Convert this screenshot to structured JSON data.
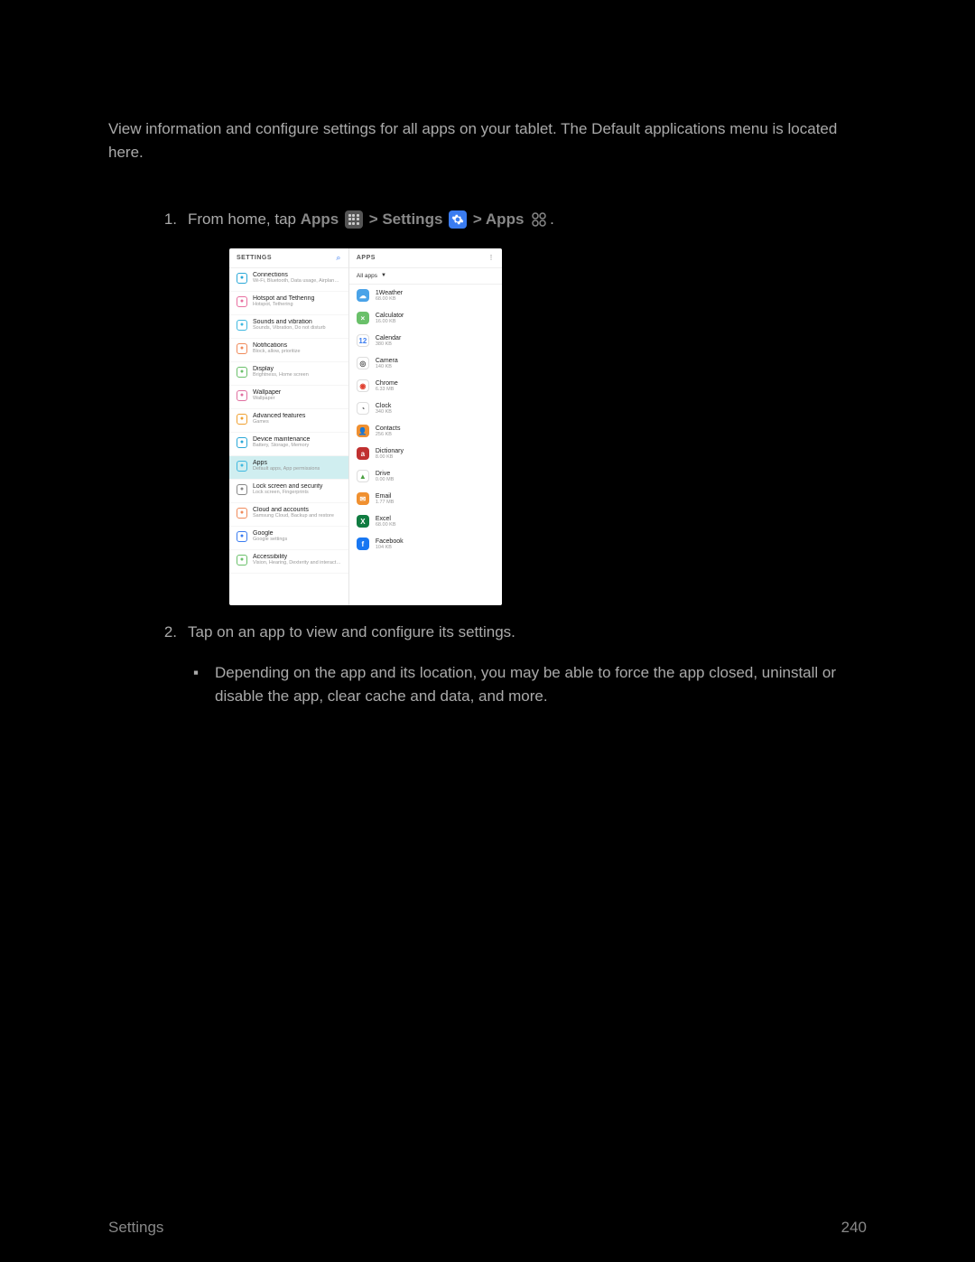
{
  "doc": {
    "intro": "View information and configure settings for all apps on your tablet. The Default applications menu is located here.",
    "step1_prefix": "From home, tap ",
    "step1_apps": "Apps",
    "step1_sep1": " > ",
    "step1_settings": "Settings",
    "step1_sep2": " > ",
    "step1_apps2": "Apps",
    "step1_suffix": ".",
    "step2": "Tap on an app to view and configure its settings.",
    "bullet": "Depending on the app and its location, you may be able to force the app closed, uninstall or disable the app, clear cache and data, and more.",
    "footer_left": "Settings",
    "footer_right": "240"
  },
  "screenshot": {
    "left_header": "SETTINGS",
    "right_header": "APPS",
    "more_glyph": "⋮",
    "filter_label": "All apps",
    "settings_items": [
      {
        "title": "Connections",
        "sub": "Wi-Fi, Bluetooth, Data usage, Airplane m...",
        "color": "#2aa8d8"
      },
      {
        "title": "Hotspot and Tethering",
        "sub": "Hotspot, Tethering",
        "color": "#e86fa0"
      },
      {
        "title": "Sounds and vibration",
        "sub": "Sounds, Vibration, Do not disturb",
        "color": "#3fb8e0"
      },
      {
        "title": "Notifications",
        "sub": "Block, allow, prioritize",
        "color": "#f08a5a"
      },
      {
        "title": "Display",
        "sub": "Brightness, Home screen",
        "color": "#6ac06a"
      },
      {
        "title": "Wallpaper",
        "sub": "Wallpaper",
        "color": "#e06fa0"
      },
      {
        "title": "Advanced features",
        "sub": "Games",
        "color": "#f0a030"
      },
      {
        "title": "Device maintenance",
        "sub": "Battery, Storage, Memory",
        "color": "#2aa8d8"
      },
      {
        "title": "Apps",
        "sub": "Default apps, App permissions",
        "color": "#3fb8e0",
        "selected": true
      },
      {
        "title": "Lock screen and security",
        "sub": "Lock screen, Fingerprints",
        "color": "#888"
      },
      {
        "title": "Cloud and accounts",
        "sub": "Samsung Cloud, Backup and restore",
        "color": "#f08a5a"
      },
      {
        "title": "Google",
        "sub": "Google settings",
        "color": "#3a7cf0"
      },
      {
        "title": "Accessibility",
        "sub": "Vision, Hearing, Dexterity and interaction",
        "color": "#6ac06a"
      }
    ],
    "apps": [
      {
        "title": "1Weather",
        "sub": "68.00 KB",
        "bg": "#4aa3e8",
        "glyph": "☁"
      },
      {
        "title": "Calculator",
        "sub": "16.00 KB",
        "bg": "#6ac06a",
        "glyph": "×"
      },
      {
        "title": "Calendar",
        "sub": "380 KB",
        "bg": "#ffffff",
        "glyph": "12",
        "fg": "#3a7cf0",
        "border": "1px solid #ddd"
      },
      {
        "title": "Camera",
        "sub": "140 KB",
        "bg": "#ffffff",
        "glyph": "◎",
        "fg": "#555",
        "border": "1px solid #ddd"
      },
      {
        "title": "Chrome",
        "sub": "6.33 MB",
        "bg": "#ffffff",
        "glyph": "◉",
        "fg": "#e04030",
        "border": "1px solid #ddd"
      },
      {
        "title": "Clock",
        "sub": "340 KB",
        "bg": "#ffffff",
        "glyph": "◔",
        "fg": "#555",
        "border": "1px solid #ddd"
      },
      {
        "title": "Contacts",
        "sub": "256 KB",
        "bg": "#f09030",
        "glyph": "👤"
      },
      {
        "title": "Dictionary",
        "sub": "8.00 KB",
        "bg": "#c03030",
        "glyph": "a"
      },
      {
        "title": "Drive",
        "sub": "0.00 MB",
        "bg": "#ffffff",
        "glyph": "▲",
        "fg": "#4aa040",
        "border": "1px solid #ddd"
      },
      {
        "title": "Email",
        "sub": "1.77 MB",
        "bg": "#f09030",
        "glyph": "✉"
      },
      {
        "title": "Excel",
        "sub": "68.00 KB",
        "bg": "#107c41",
        "glyph": "X"
      },
      {
        "title": "Facebook",
        "sub": "104 KB",
        "bg": "#1877f2",
        "glyph": "f"
      }
    ]
  }
}
